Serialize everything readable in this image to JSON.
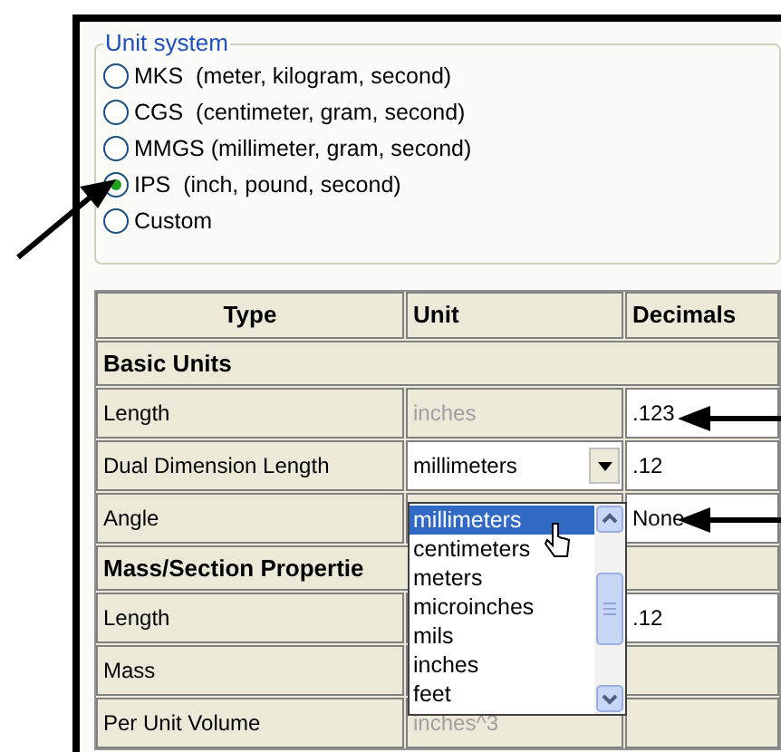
{
  "unit_system": {
    "title": "Unit system",
    "options": [
      {
        "label": "MKS  (meter, kilogram, second)",
        "selected": false
      },
      {
        "label": "CGS  (centimeter, gram, second)",
        "selected": false
      },
      {
        "label": "MMGS (millimeter, gram, second)",
        "selected": false
      },
      {
        "label": "IPS  (inch, pound, second)",
        "selected": true
      },
      {
        "label": "Custom",
        "selected": false
      }
    ]
  },
  "table": {
    "columns": [
      "Type",
      "Unit",
      "Decimals"
    ],
    "rows": [
      {
        "kind": "section",
        "type": "Basic Units"
      },
      {
        "kind": "row",
        "type": "Length",
        "unit": {
          "kind": "static",
          "value": "inches"
        },
        "decimals": ".123"
      },
      {
        "kind": "row",
        "type": "Dual Dimension Length",
        "unit": {
          "kind": "combo",
          "value": "millimeters"
        },
        "decimals": ".12"
      },
      {
        "kind": "row",
        "type": "Angle",
        "decimals": "None"
      },
      {
        "kind": "section",
        "type": "Mass/Section Propertie"
      },
      {
        "kind": "row",
        "type": "Length",
        "decimals": ".12"
      },
      {
        "kind": "row",
        "type": "Mass"
      },
      {
        "kind": "row",
        "type": "Per Unit Volume",
        "unit": {
          "kind": "static",
          "value": "inches^3"
        }
      }
    ]
  },
  "dropdown_list": {
    "items": [
      {
        "label": "millimeters",
        "selected": true
      },
      {
        "label": "centimeters",
        "selected": false
      },
      {
        "label": "meters",
        "selected": false
      },
      {
        "label": "microinches",
        "selected": false
      },
      {
        "label": "mils",
        "selected": false
      },
      {
        "label": "inches",
        "selected": false
      },
      {
        "label": "feet",
        "selected": false
      }
    ]
  }
}
